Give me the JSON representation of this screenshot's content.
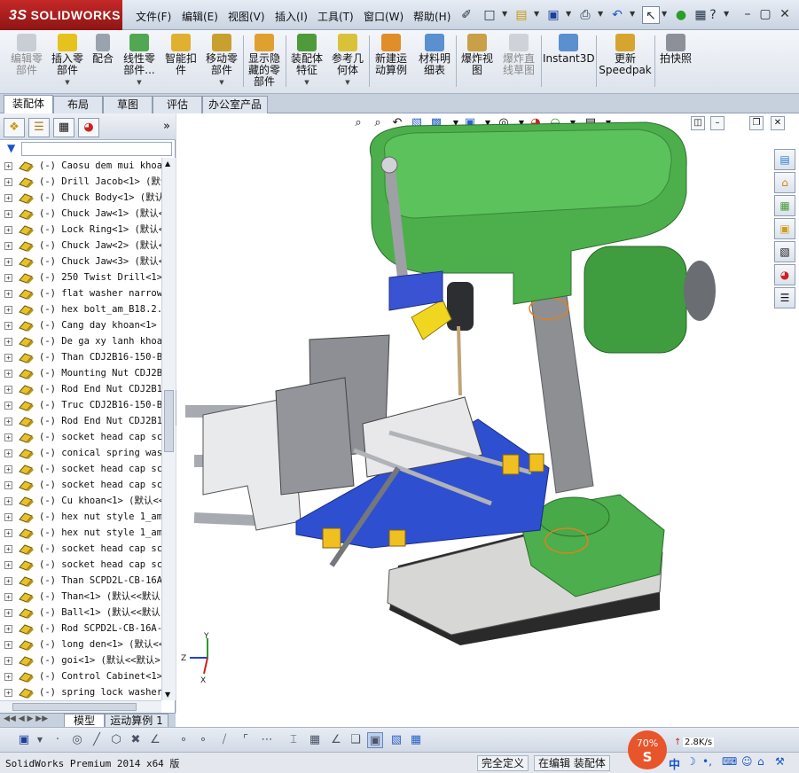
{
  "app": {
    "logo_prefix": "3S",
    "logo_text": "SOLIDWORKS",
    "brand_color": "#c62828"
  },
  "menu": [
    "文件(F)",
    "编辑(E)",
    "视图(V)",
    "插入(I)",
    "工具(T)",
    "窗口(W)",
    "帮助(H)"
  ],
  "ribbon": [
    {
      "label1": "编辑零",
      "label2": "部件",
      "icon": "edit-component-icon",
      "disabled": true
    },
    {
      "label1": "插入零",
      "label2": "部件",
      "icon": "insert-components-icon",
      "disabled": false,
      "caret": true
    },
    {
      "label1": "配合",
      "label2": "",
      "icon": "mate-icon",
      "disabled": false
    },
    {
      "label1": "线性零",
      "label2": "部件...",
      "icon": "linear-pattern-icon",
      "disabled": false,
      "caret": true
    },
    {
      "label1": "智能扣",
      "label2": "件",
      "icon": "smart-fasteners-icon",
      "disabled": false
    },
    {
      "label1": "移动零",
      "label2": "部件",
      "icon": "move-component-icon",
      "disabled": false,
      "caret": true
    },
    {
      "label1": "显示隐",
      "label2": "藏的零",
      "label3": "部件",
      "icon": "show-hidden-components-icon",
      "disabled": false
    },
    {
      "label1": "装配体",
      "label2": "特征",
      "icon": "assembly-features-icon",
      "disabled": false,
      "caret": true
    },
    {
      "label1": "参考几",
      "label2": "何体",
      "icon": "reference-geometry-icon",
      "disabled": false,
      "caret": true
    },
    {
      "label1": "新建运",
      "label2": "动算例",
      "icon": "new-motion-study-icon",
      "disabled": false
    },
    {
      "label1": "材料明",
      "label2": "细表",
      "icon": "bill-of-materials-icon",
      "disabled": false
    },
    {
      "label1": "爆炸视",
      "label2": "图",
      "icon": "exploded-view-icon",
      "disabled": false
    },
    {
      "label1": "爆炸直",
      "label2": "线草图",
      "icon": "explode-line-sketch-icon",
      "disabled": true
    },
    {
      "label1": "Instant3D",
      "label2": "",
      "icon": "instant3d-icon",
      "disabled": false
    },
    {
      "label1": "更新",
      "label2": "Speedpak",
      "icon": "update-speedpak-icon",
      "disabled": false
    },
    {
      "label1": "拍快照",
      "label2": "",
      "icon": "take-snapshot-icon",
      "disabled": false
    }
  ],
  "command_tabs": [
    "装配体",
    "布局",
    "草图",
    "评估",
    "办公室产品"
  ],
  "active_command_tab": "装配体",
  "tree_items": [
    "(-) Caosu dem mui khoan",
    "(-) Drill Jacob<1> (默认",
    "(-) Chuck Body<1> (默认<",
    "(-) Chuck Jaw<1> (默认<",
    "(-) Lock Ring<1> (默认<",
    "(-) Chuck Jaw<2> (默认<",
    "(-) Chuck Jaw<3> (默认<",
    "(-) 250 Twist Drill<1>",
    "(-) flat washer narrow_",
    "(-) hex bolt_am_B18.2.3",
    "(-) Cang day khoan<1> (",
    "(-) De ga xy lanh khoan",
    "(-) Than CDJ2B16-150-B<",
    "(-) Mounting Nut CDJ2B1",
    "(-) Rod End Nut CDJ2B16",
    "(-) Truc CDJ2B16-150-B<",
    "(-) Rod End Nut CDJ2B16",
    "(-) socket head cap scr",
    "(-) conical spring wash",
    "(-) socket head cap scr",
    "(-) socket head cap scr",
    "(-) Cu khoan<1> (默认<<",
    "(-) hex nut style 1_am_",
    "(-) hex nut style 1_am_",
    "(-) socket head cap scr",
    "(-) socket head cap scr",
    "(-) Than SCPD2L-CB-16A-",
    "(-) Than<1> (默认<<默认",
    "(-) Ball<1> (默认<<默认",
    "(-) Rod SCPD2L-CB-16A-5",
    "(-) long den<1> (默认<<",
    "(-) goi<1> (默认<<默认>",
    "(-) Control Cabinet<1>",
    "(-) spring lock washer_"
  ],
  "bottom_tabs": [
    "模型",
    "运动算例 1"
  ],
  "status": {
    "app_version": "SolidWorks Premium 2014 x64 版",
    "definition": "完全定义",
    "editing": "在编辑 装配体"
  },
  "ime": {
    "percent": "70%",
    "speed": "2.8K/s",
    "lang": "中"
  },
  "triad": {
    "x": "X",
    "y": "Y",
    "z": "Z"
  }
}
